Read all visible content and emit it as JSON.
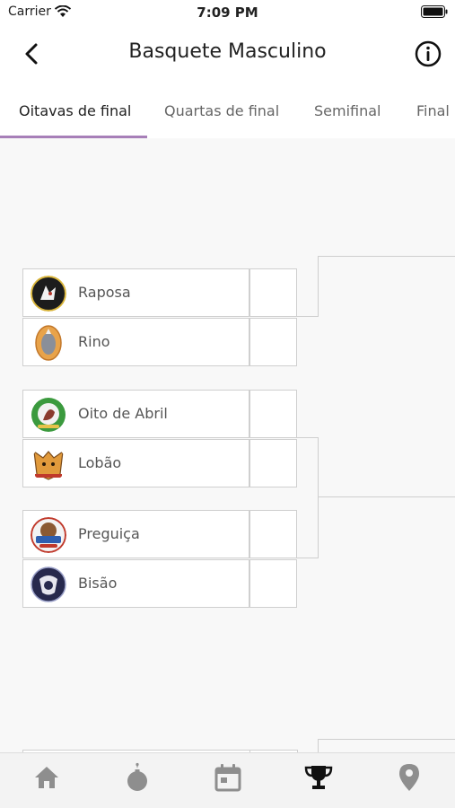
{
  "status_bar": {
    "carrier": "Carrier",
    "time": "7:09 PM"
  },
  "header": {
    "title": "Basquete Masculino",
    "back_icon": "chevron-left-icon",
    "info_icon": "info-circle-icon"
  },
  "tabs": [
    {
      "label": "Oitavas de final",
      "active": true
    },
    {
      "label": "Quartas de final",
      "active": false
    },
    {
      "label": "Semifinal",
      "active": false
    },
    {
      "label": "Final",
      "active": false
    }
  ],
  "matches": [
    {
      "teams": [
        {
          "name": "Raposa",
          "logo": "raposa-logo"
        },
        {
          "name": "Rino",
          "logo": "rino-logo"
        }
      ]
    },
    {
      "teams": [
        {
          "name": "Oito de Abril",
          "logo": "oito-de-abril-logo"
        },
        {
          "name": "Lobão",
          "logo": "lobao-logo"
        }
      ]
    },
    {
      "teams": [
        {
          "name": "Preguiça",
          "logo": "preguica-logo"
        },
        {
          "name": "Bisão",
          "logo": "bisao-logo"
        }
      ]
    }
  ],
  "bottom_tabs": [
    {
      "icon": "home-icon",
      "active": false
    },
    {
      "icon": "bomb-icon",
      "active": false
    },
    {
      "icon": "calendar-icon",
      "active": false
    },
    {
      "icon": "trophy-icon",
      "active": true
    },
    {
      "icon": "map-pin-icon",
      "active": false
    }
  ],
  "colors": {
    "accent": "#a77fb8",
    "line": "#cfcfcf",
    "inactive_icon": "#8e8e8e",
    "active_icon": "#111111"
  }
}
